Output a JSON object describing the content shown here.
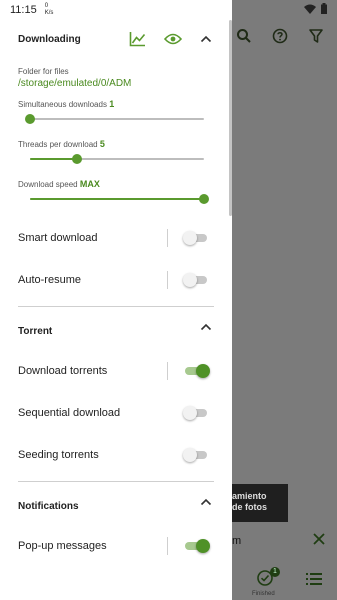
{
  "status_bar": {
    "time": "11:15",
    "net_speed": "0\nK/s"
  },
  "background_app": {
    "ad_text_line1": "amiento",
    "ad_text_line2": "de fotos",
    "dismiss_text": "m",
    "finished_label": "Finished",
    "finished_badge": "1"
  },
  "downloading": {
    "title": "Downloading",
    "folder_label": "Folder for files",
    "folder_path": "/storage/emulated/0/ADM",
    "simultaneous_label": "Simultaneous downloads",
    "simultaneous_value": "1",
    "simultaneous_fraction": 0.0,
    "threads_label": "Threads per download",
    "threads_value": "5",
    "threads_fraction": 0.27,
    "speed_label": "Download speed",
    "speed_value": "MAX",
    "speed_fraction": 1.0,
    "smart_download": {
      "label": "Smart download",
      "on": false
    },
    "auto_resume": {
      "label": "Auto-resume",
      "on": false
    }
  },
  "torrent": {
    "title": "Torrent",
    "download_torrents": {
      "label": "Download torrents",
      "on": true
    },
    "sequential_download": {
      "label": "Sequential download",
      "on": false
    },
    "seeding_torrents": {
      "label": "Seeding torrents",
      "on": false
    }
  },
  "notifications": {
    "title": "Notifications",
    "popup_messages": {
      "label": "Pop-up messages",
      "on": true
    }
  },
  "colors": {
    "accent": "#5a9a2e",
    "accent_dark": "#4f9127",
    "scrim": "#7b7b7b"
  }
}
